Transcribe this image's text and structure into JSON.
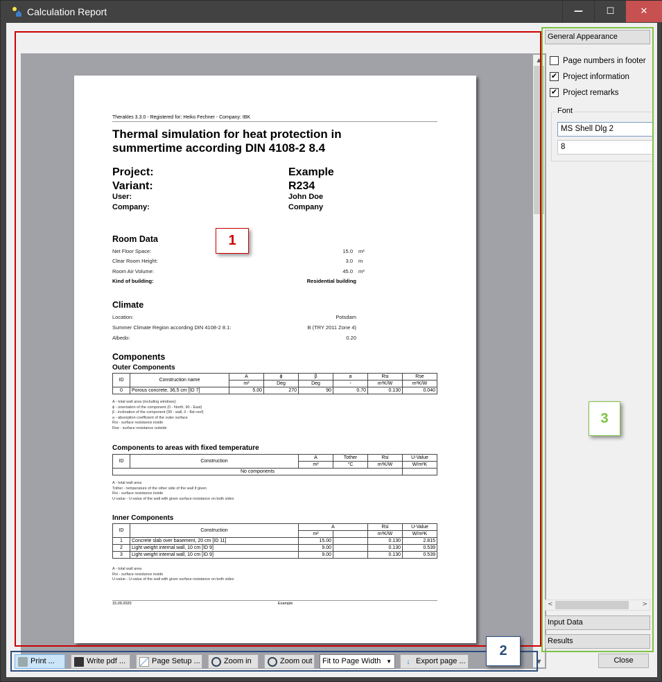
{
  "window": {
    "title": "Calculation Report",
    "minimize": "—",
    "maximize": "☐",
    "close": "✕"
  },
  "page": {
    "header": "Therakles 3.3.0 - Registered for: Heiko Fechner - Company: IBK",
    "title_line1": "Thermal simulation for heat protection in",
    "title_line2": "summertime according DIN 4108-2 8.4",
    "project_label": "Project:",
    "project_value": "Example",
    "variant_label": "Variant:",
    "variant_value": "R234",
    "user_label": "User:",
    "user_value": "John Doe",
    "company_label": "Company:",
    "company_value": "Company",
    "room_data": {
      "heading": "Room Data",
      "rows": [
        {
          "label": "Net Floor Space:",
          "value": "15.0",
          "unit": "m²"
        },
        {
          "label": "Clear Room Height:",
          "value": "3.0",
          "unit": "m"
        },
        {
          "label": "Room Air Volume:",
          "value": "45.0",
          "unit": "m³"
        }
      ],
      "kind_label": "Kind of building:",
      "kind_value": "Residential building"
    },
    "climate": {
      "heading": "Climate",
      "rows": [
        {
          "label": "Location:",
          "value": "Potsdam"
        },
        {
          "label": "Summer Climate Region according DIN 4108-2 8.1:",
          "value": "B (TRY 2011 Zone 4)"
        },
        {
          "label": "Albedo:",
          "value": "0.20"
        }
      ]
    },
    "components": {
      "heading": "Components",
      "outer": {
        "heading": "Outer Components",
        "headers": [
          "ID",
          "Construction name",
          "A",
          "ϕ",
          "β",
          "a",
          "Rsi",
          "Rse"
        ],
        "units": [
          "m²",
          "Deg",
          "Deg",
          "-",
          "m²K/W",
          "m²K/W"
        ],
        "rows": [
          [
            "0",
            "Porous concrete, 36,5 cm [ID 7]",
            "5.00",
            "270",
            "90",
            "0.70",
            "0.130",
            "0.040"
          ]
        ],
        "notes": [
          "A - total wall area (including windows)",
          "ϕ - orientation of the component (0 - North, 90 - East)",
          "β - inclination of the component (90 - wall, 0 - flat roof)",
          "a - absorption coefficient of the outer surface",
          "Rsi - surface resistance inside",
          "Rse - surface resistance outside"
        ]
      },
      "fixed": {
        "heading": "Components to areas with fixed temperature",
        "headers": [
          "ID",
          "Construction",
          "A",
          "Tother",
          "Rsi",
          "U-Value"
        ],
        "units": [
          "m²",
          "°C",
          "m²K/W",
          "W/m²K"
        ],
        "empty": "No components",
        "notes": [
          "A - total wall area",
          "Tother - temperature of the other side of the wall if given",
          "Rsi - surface resistance inside",
          "U-value - U-value of the wall with given surface resistance on both sides"
        ]
      },
      "inner": {
        "heading": "Inner Components",
        "headers": [
          "ID",
          "Construction",
          "A",
          "Rsi",
          "U-Value"
        ],
        "units": [
          "m²",
          "m²K/W",
          "W/m²K"
        ],
        "rows": [
          [
            "1",
            "Concrete slab over basement, 20 cm [ID 11]",
            "15.00",
            "0.130",
            "2.815"
          ],
          [
            "2",
            "Light weight internal wall, 10 cm [ID 9]",
            "9.00",
            "0.130",
            "0.539"
          ],
          [
            "3",
            "Light weight internal wall, 10 cm [ID 9]",
            "9.00",
            "0.130",
            "0.539"
          ]
        ],
        "notes": [
          "A - total wall area",
          "Rsi - surface resistance inside",
          "U-value - U-value of the wall with given surface resistance on both sides"
        ]
      }
    },
    "footer_date": "15.09.2020",
    "footer_center": "Example"
  },
  "annotations": {
    "a1": "1",
    "a2": "2",
    "a3": "3",
    "colors": {
      "a1": "#cc0000",
      "a2": "#2a4d7c",
      "a3": "#7dc242"
    }
  },
  "panel": {
    "general": "General Appearance",
    "checks": [
      {
        "label": "Page numbers in footer",
        "checked": false
      },
      {
        "label": "Project information",
        "checked": true
      },
      {
        "label": "Project remarks",
        "checked": true
      }
    ],
    "font_label": "Font",
    "font_name": "MS Shell Dlg 2",
    "font_size": "8",
    "input_data": "Input Data",
    "results": "Results"
  },
  "toolbar": {
    "print": "Print ...",
    "pdf": "Write pdf ...",
    "setup": "Page Setup ...",
    "zoom_in": "Zoom in",
    "zoom_out": "Zoom out",
    "fit": "Fit to Page Width",
    "export": "Export page ..."
  },
  "close": "Close"
}
